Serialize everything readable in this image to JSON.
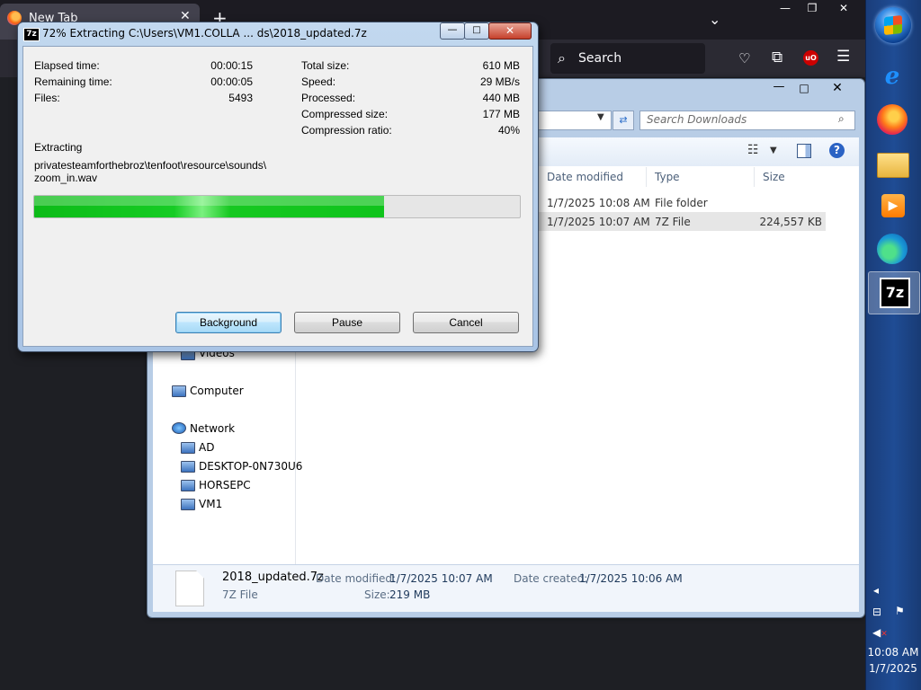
{
  "firefox": {
    "tab_title": "New Tab",
    "tab_close": "✕",
    "new_tab": "+",
    "list_all": "⌄",
    "minimize": "—",
    "maximize": "❐",
    "close": "✕",
    "search_placeholder": "Search",
    "ublock_label": "uO"
  },
  "explorer": {
    "search_placeholder": "Search Downloads",
    "columns": {
      "date": "Date modified",
      "type": "Type",
      "size": "Size"
    },
    "rows": [
      {
        "date": "1/7/2025 10:08 AM",
        "type": "File folder",
        "size": ""
      },
      {
        "date": "1/7/2025 10:07 AM",
        "type": "7Z File",
        "size": "224,557 KB"
      }
    ],
    "nav": {
      "videos": "Videos",
      "computer": "Computer",
      "network": "Network",
      "network_items": [
        "AD",
        "DESKTOP-0N730U6",
        "HORSEPC",
        "VM1"
      ]
    },
    "details": {
      "name": "2018_updated.7z",
      "kind": "7Z File",
      "date_modified_label": "Date modified:",
      "date_modified": "1/7/2025 10:07 AM",
      "date_created_label": "Date created:",
      "date_created": "1/7/2025 10:06 AM",
      "size_label": "Size:",
      "size": "219 MB"
    }
  },
  "dialog": {
    "icon_text": "7z",
    "title": "72% Extracting C:\\Users\\VM1.COLLA ... ds\\2018_updated.7z",
    "close": "✕",
    "left_stats": [
      {
        "label": "Elapsed time:",
        "value": "00:00:15"
      },
      {
        "label": "Remaining time:",
        "value": "00:00:05"
      },
      {
        "label": "Files:",
        "value": "5493"
      }
    ],
    "right_stats": [
      {
        "label": "Total size:",
        "value": "610 MB"
      },
      {
        "label": "Speed:",
        "value": "29 MB/s"
      },
      {
        "label": "Processed:",
        "value": "440 MB"
      },
      {
        "label": "Compressed size:",
        "value": "177 MB"
      },
      {
        "label": "Compression ratio:",
        "value": "40%"
      }
    ],
    "status_label": "Extracting",
    "current_path_line1": "privatesteamforthebroz\\tenfoot\\resource\\sounds\\",
    "current_path_line2": "zoom_in.wav",
    "progress": 0.72,
    "buttons": {
      "background": "Background",
      "pause": "Pause",
      "cancel": "Cancel"
    }
  },
  "taskbar": {
    "ie_glyph": "e",
    "wmp_glyph": "▶",
    "sevenzip_label": "7z",
    "tray_chevron": "◂",
    "clock_time": "10:08 AM",
    "clock_date": "1/7/2025"
  }
}
